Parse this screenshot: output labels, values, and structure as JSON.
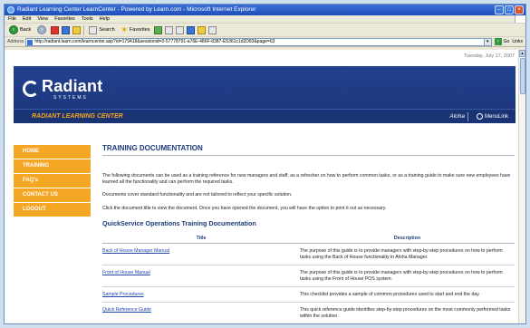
{
  "window": {
    "title": "Radiant Learning Center LearnCenter - Powered by Learn.com - Microsoft Internet Explorer",
    "minimize": "–",
    "maximize": "□",
    "close": "×"
  },
  "menu": [
    "File",
    "Edit",
    "View",
    "Favorites",
    "Tools",
    "Help"
  ],
  "toolbar": {
    "back_label": "Back",
    "search_label": "Search",
    "favorites_label": "Favorites"
  },
  "address": {
    "label": "Address",
    "url": "http://radiant.learn.com/learncenter.asp?id=179418&sessionid=3-57778791-a76E-486F-8387-E5361c1d2D83&page=63",
    "go_label": "Go",
    "links_label": "Links"
  },
  "page": {
    "date": "Tuesday, July 17, 2007",
    "brand": {
      "name": "Radiant",
      "sub": "SYSTEMS",
      "center_title": "RADIANT LEARNING CENTER",
      "aloha": "Aloha",
      "menusoft": "MenuLink"
    },
    "nav": [
      "HOME",
      "TRAINING",
      "FAQ's",
      "CONTACT US",
      "LOGOUT"
    ],
    "title": "TRAINING DOCUMENTATION",
    "intro": [
      "The following documents can be used as a training reference for new managers and staff, as a refresher on how to perform common tasks, or as a training guide to make sure new employees have learned all the functionality and can perform the required tasks.",
      "Documents cover standard functionality and are not tailored to reflect your specific solution.",
      "Click the document title to view the document. Once you have opened the document, you will have the option to print it out as necessary."
    ],
    "section_title": "QuickService Operations Training Documentation",
    "table": {
      "headers": [
        "Title",
        "Description"
      ],
      "rows": [
        {
          "title": "Back of House Manager Manual",
          "description": "The purpose of this guide is to provide managers with step-by-step procedures on how to perform tasks using the Back of House functionality in Aloha Manager."
        },
        {
          "title": "Front of House Manual",
          "description": "The purpose of this guide is to provide managers with step-by-step procedures on how to perform tasks using the Front of House POS system."
        },
        {
          "title": "Sample Procedures",
          "description": "This checklist provides a sample of common procedures used to start and end the day."
        },
        {
          "title": "Quick Reference Guide",
          "description": "This quick reference guide identifies step-by-step procedures on the most commonly performed tasks within the solution."
        }
      ]
    }
  }
}
